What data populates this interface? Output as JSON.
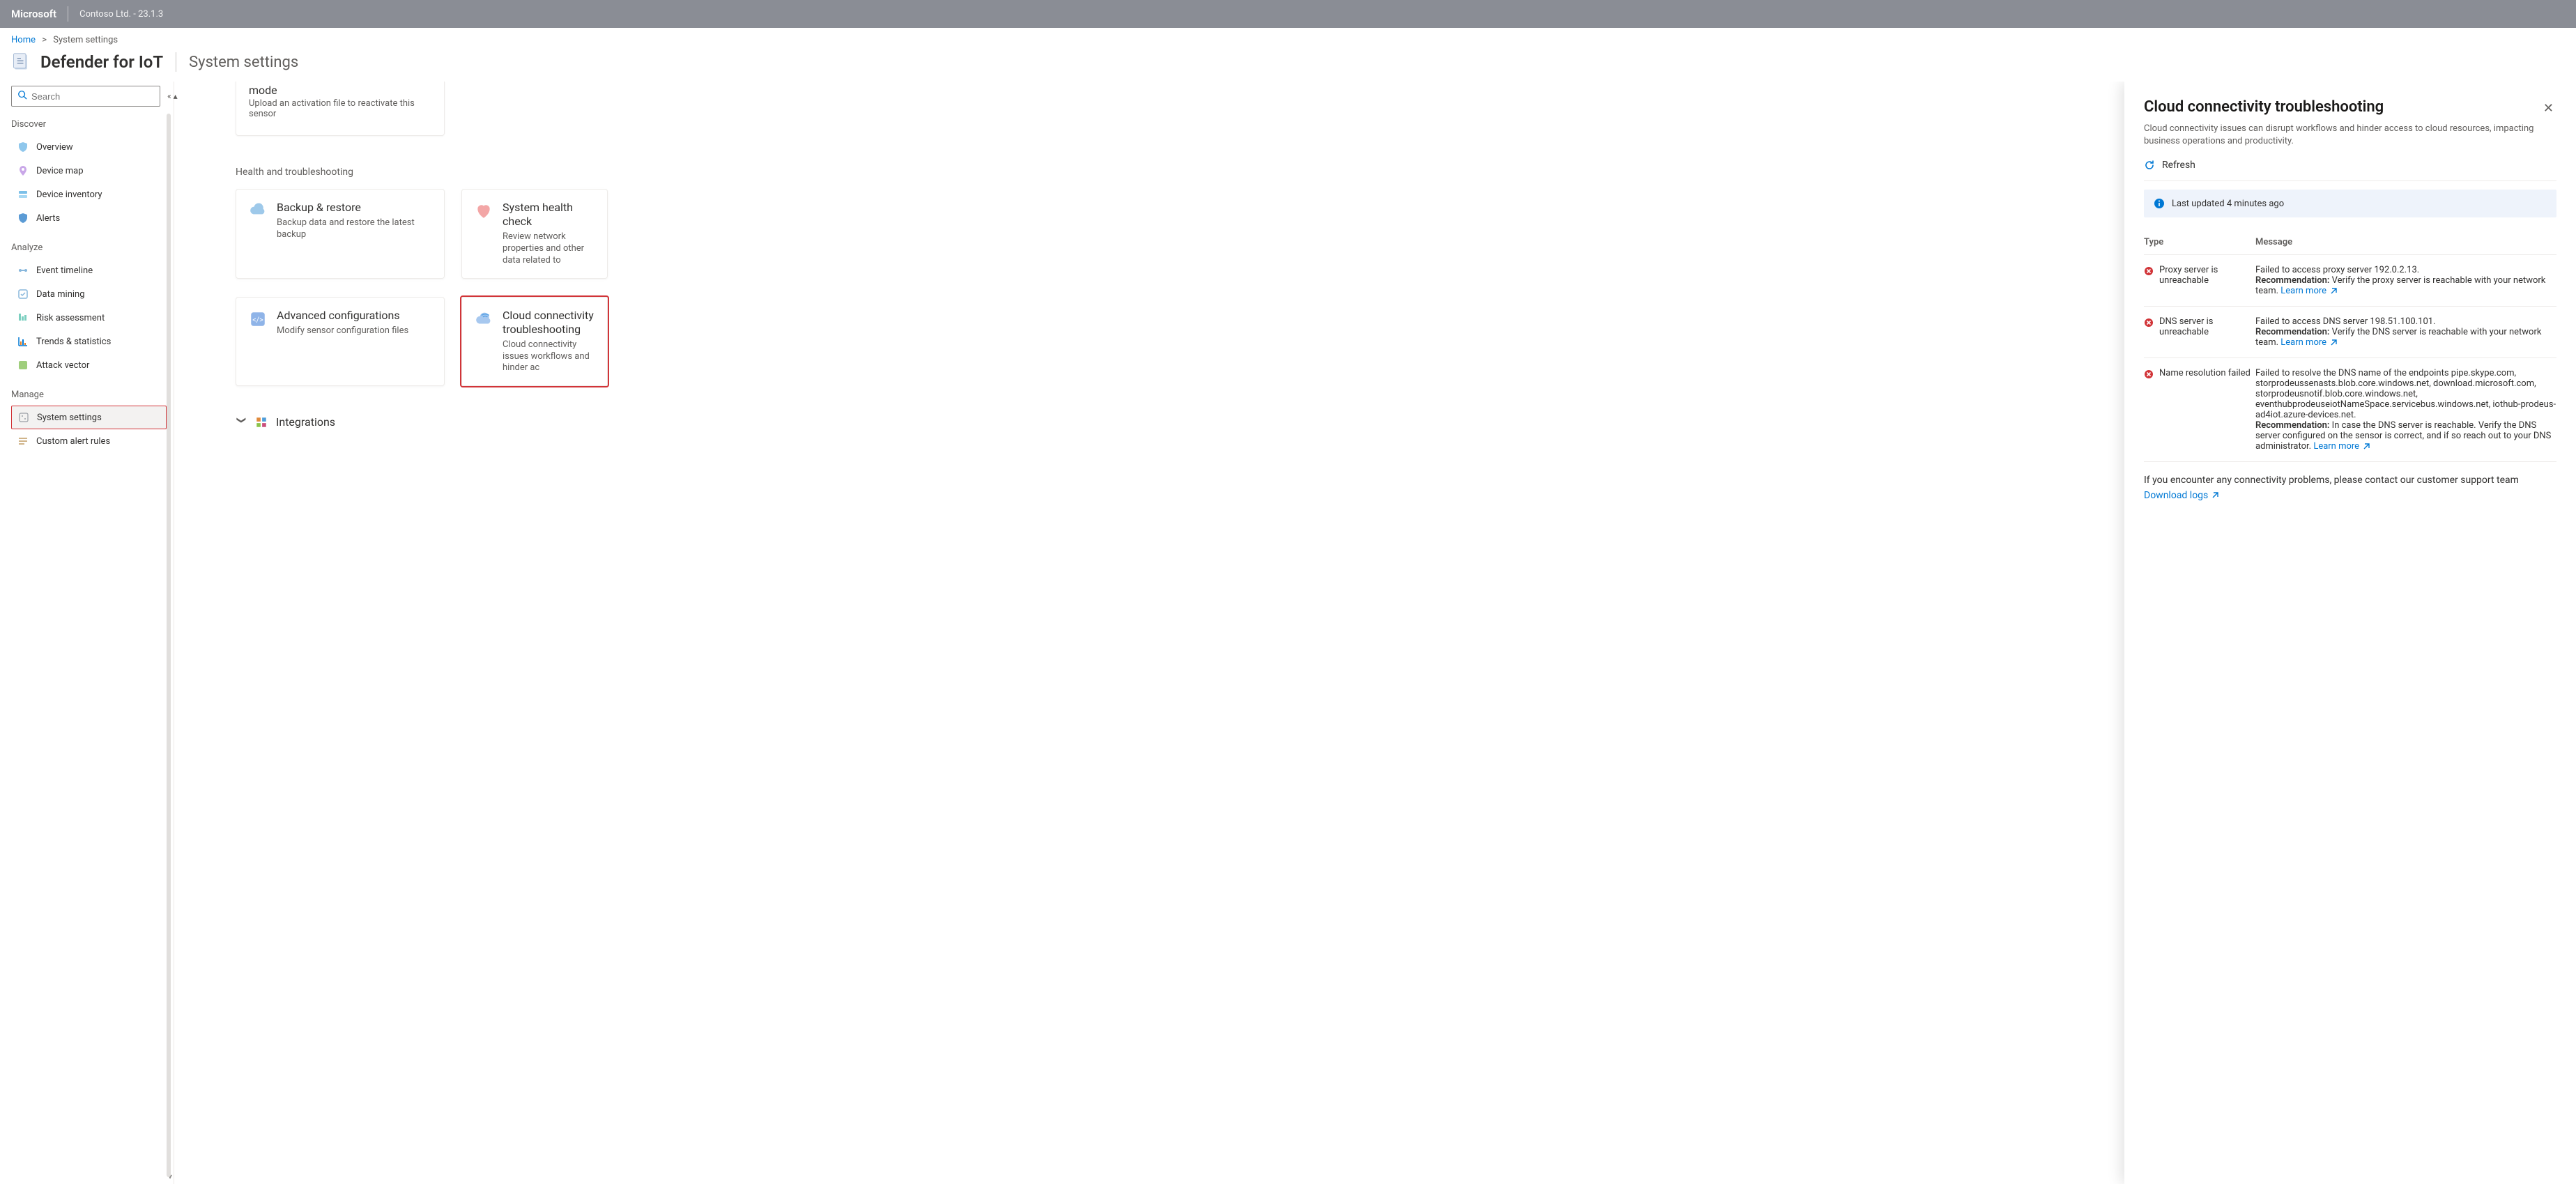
{
  "topbar": {
    "brand": "Microsoft",
    "tenant": "Contoso Ltd. - 23.1.3"
  },
  "breadcrumb": {
    "home": "Home",
    "current": "System settings"
  },
  "header": {
    "app_title": "Defender for IoT",
    "subpage": "System settings"
  },
  "search": {
    "placeholder": "Search"
  },
  "nav": {
    "discover_label": "Discover",
    "discover": [
      {
        "label": "Overview"
      },
      {
        "label": "Device map"
      },
      {
        "label": "Device inventory"
      },
      {
        "label": "Alerts"
      }
    ],
    "analyze_label": "Analyze",
    "analyze": [
      {
        "label": "Event timeline"
      },
      {
        "label": "Data mining"
      },
      {
        "label": "Risk assessment"
      },
      {
        "label": "Trends & statistics"
      },
      {
        "label": "Attack vector"
      }
    ],
    "manage_label": "Manage",
    "manage": [
      {
        "label": "System settings",
        "active": true
      },
      {
        "label": "Custom alert rules"
      }
    ]
  },
  "partial_card": {
    "title": "mode",
    "desc": "Upload an activation file to reactivate this sensor"
  },
  "section_health": "Health and troubleshooting",
  "cards_row1": [
    {
      "title": "Backup & restore",
      "desc": "Backup data and restore the latest backup"
    },
    {
      "title": "System health check",
      "desc": "Review network properties and other data related to"
    }
  ],
  "cards_row2": [
    {
      "title": "Advanced configurations",
      "desc": "Modify sensor configuration files"
    },
    {
      "title": "Cloud connectivity troubleshooting",
      "desc": "Cloud connectivity issues workflows and hinder ac"
    }
  ],
  "integrations_label": "Integrations",
  "panel": {
    "title": "Cloud connectivity troubleshooting",
    "subtitle": "Cloud connectivity issues can disrupt workflows and hinder access to cloud resources, impacting business operations and productivity.",
    "refresh": "Refresh",
    "last_updated": "Last updated 4 minutes ago",
    "col_type": "Type",
    "col_msg": "Message",
    "rows": [
      {
        "type": "Proxy server is unreachable",
        "message": "Failed to access proxy server 192.0.2.13.",
        "rec_label": "Recommendation:",
        "rec": " Verify the proxy server is reachable with your network team. ",
        "learn": "Learn more"
      },
      {
        "type": "DNS server is unreachable",
        "message": "Failed to access DNS server 198.51.100.101.",
        "rec_label": "Recommendation:",
        "rec": " Verify the DNS server is reachable with your network team. ",
        "learn": "Learn more"
      },
      {
        "type": "Name resolution failed",
        "message": "Failed to resolve the DNS name of the endpoints pipe.skype.com, storprodeussenasts.blob.core.windows.net, download.microsoft.com, storprodeusnotif.blob.core.windows.net, eventhubprodeuseiotNameSpace.servicebus.windows.net, iothub-prodeus-ad4iot.azure-devices.net.",
        "rec_label": "Recommendation:",
        "rec": " In case the DNS server is reachable. Verify the DNS server configured on the sensor is correct, and if so reach out to your DNS administrator. ",
        "learn": "Learn more"
      }
    ],
    "footer_note": "If you encounter any connectivity problems, please contact our customer support team",
    "download": "Download logs"
  },
  "icons": {
    "search": "search-icon",
    "collapse": "collapse-icon"
  },
  "colors": {
    "accent": "#0078d4",
    "danger": "#d13438"
  }
}
